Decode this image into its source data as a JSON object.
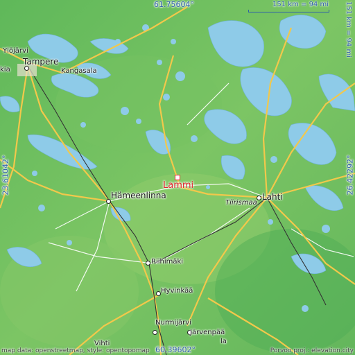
{
  "map": {
    "place_name": "Lammi",
    "coords": {
      "top": "61.75604°",
      "bottom": "60.39602°",
      "left": "23.61042°",
      "right": "26.42292°"
    },
    "scale": {
      "horizontal": "151 km = 94 mi",
      "vertical": "151 km = 94 mi"
    },
    "places": [
      {
        "id": "ylojarvi",
        "label": "Ylöjärvi"
      },
      {
        "id": "tampere",
        "label": "Tampere"
      },
      {
        "id": "kangasala",
        "label": "Kangasala"
      },
      {
        "id": "hameenlinna",
        "label": "Hämeenlinna"
      },
      {
        "id": "lahti",
        "label": "Lahti"
      },
      {
        "id": "tiirismaa",
        "label": "Tiirismaa"
      },
      {
        "id": "riihimaki",
        "label": "Riihimäki"
      },
      {
        "id": "hyvinkaa",
        "label": "Hyvinkää"
      },
      {
        "id": "nurmijarvi",
        "label": "Nurmijärvi"
      },
      {
        "id": "jarvenpaa",
        "label": "Järvenpää"
      },
      {
        "id": "vihti",
        "label": "Vihti"
      },
      {
        "id": "kia",
        "label": "kia"
      },
      {
        "id": "la",
        "label": "la"
      },
      {
        "id": "porvoo",
        "label": "Porvoo"
      }
    ],
    "attribution_left": "map data: openstreetmap, style: opentopomap",
    "attribution_right": "Porvoo proj.: elevation.city",
    "colors": {
      "land": "#6fbf5a",
      "water": "#8ecbe8",
      "road_major": "#f2c84b",
      "road_minor": "#ffffff",
      "rail": "#333333",
      "highlight": "#e0262b"
    }
  }
}
